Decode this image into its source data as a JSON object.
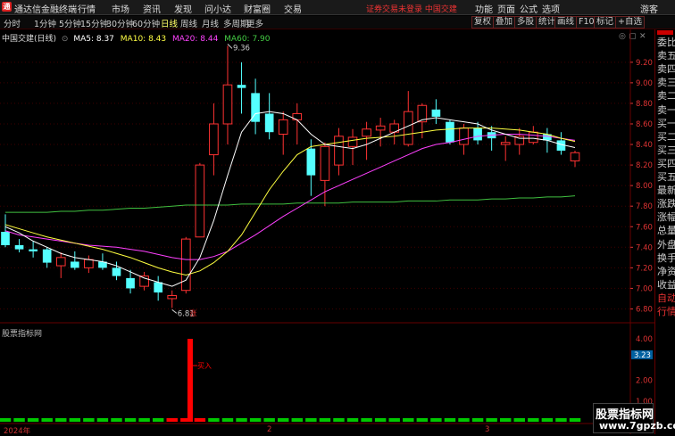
{
  "app": {
    "title": "通达信金融终端",
    "logo": "通"
  },
  "menu": [
    "行情",
    "市场",
    "资讯",
    "发现",
    "问小达",
    "财富圈",
    "交易"
  ],
  "status_text": "证券交易未登录  中国交建",
  "right_menu": [
    "功能",
    "页面",
    "公式",
    "选项"
  ],
  "guest_label": "游客",
  "period_tabs": [
    "分时",
    "1分钟",
    "5分钟",
    "15分钟",
    "30分钟",
    "60分钟",
    "日线",
    "周线",
    "月线",
    "多周期",
    "更多"
  ],
  "active_tab": "日线",
  "toolbar_buttons": [
    "复权",
    "叠加",
    "多股",
    "统计",
    "画线",
    "F10",
    "标记",
    "+自选"
  ],
  "legend": {
    "stock": "中国交建(日线)",
    "ma5": "MA5: 8.37",
    "ma10": "MA10: 8.43",
    "ma20": "MA20: 8.44",
    "ma60": "MA60: 7.90"
  },
  "colors": {
    "up": "#ff3232",
    "down": "#54ffff",
    "ma5": "#ffffff",
    "ma10": "#ffff40",
    "ma20": "#ff40ff",
    "ma60": "#40c040",
    "volume": "#00c800",
    "signal": "#ff0000",
    "grid": "#400000"
  },
  "right_panel": [
    "委比",
    "卖五",
    "卖四",
    "卖三",
    "卖二",
    "卖一",
    "买一",
    "买二",
    "买三",
    "买四",
    "买五",
    "最新",
    "涨跌",
    "涨幅",
    "总量",
    "外盘",
    "换手",
    "净资",
    "收益",
    "自动",
    "行情"
  ],
  "right_panel_top": "L",
  "price_axis": [
    "9.20",
    "9.00",
    "8.80",
    "8.60",
    "8.40",
    "8.20",
    "8.00",
    "7.80",
    "7.60",
    "7.40",
    "7.20",
    "7.00",
    "6.80"
  ],
  "annotations": {
    "high": "9.36",
    "low": "6.81",
    "mark": "涨"
  },
  "indicator": {
    "title": "股票指标网",
    "signal_label": "买入",
    "axis": [
      "4.00",
      "3.23",
      "2.00",
      "1.00",
      "0.00"
    ],
    "highlight": "3.23"
  },
  "date_axis": {
    "start": "2024年",
    "mid1": "2",
    "mid2": "3"
  },
  "bottom_text": "股票指标网",
  "badge": {
    "title": "股票指标网",
    "url": "www.7gpzb.com"
  },
  "chart_data": {
    "type": "candlestick",
    "ylim": [
      6.7,
      9.45
    ],
    "candles": [
      [
        7.55,
        7.72,
        7.4,
        7.42
      ],
      [
        7.42,
        7.48,
        7.35,
        7.38
      ],
      [
        7.38,
        7.46,
        7.3,
        7.36
      ],
      [
        7.38,
        7.4,
        7.2,
        7.25
      ],
      [
        7.22,
        7.35,
        7.1,
        7.3
      ],
      [
        7.26,
        7.36,
        7.18,
        7.2
      ],
      [
        7.2,
        7.32,
        7.15,
        7.28
      ],
      [
        7.26,
        7.34,
        7.18,
        7.2
      ],
      [
        7.2,
        7.26,
        7.08,
        7.12
      ],
      [
        7.1,
        7.18,
        6.95,
        7.0
      ],
      [
        7.02,
        7.16,
        6.98,
        7.12
      ],
      [
        7.06,
        7.12,
        6.88,
        6.96
      ],
      [
        6.9,
        6.98,
        6.81,
        6.93
      ],
      [
        6.98,
        7.5,
        6.95,
        7.48
      ],
      [
        7.5,
        8.22,
        7.5,
        8.2
      ],
      [
        8.3,
        8.8,
        8.1,
        8.6
      ],
      [
        8.6,
        9.36,
        8.4,
        8.98
      ],
      [
        8.98,
        9.2,
        8.7,
        8.95
      ],
      [
        8.9,
        9.04,
        8.5,
        8.62
      ],
      [
        8.7,
        8.9,
        8.45,
        8.52
      ],
      [
        8.5,
        8.72,
        8.3,
        8.64
      ],
      [
        8.64,
        8.8,
        8.4,
        8.7
      ],
      [
        8.36,
        8.45,
        7.9,
        8.1
      ],
      [
        8.05,
        8.42,
        7.8,
        8.38
      ],
      [
        8.2,
        8.56,
        8.1,
        8.48
      ],
      [
        8.38,
        8.55,
        8.2,
        8.47
      ],
      [
        8.48,
        8.62,
        8.25,
        8.55
      ],
      [
        8.54,
        8.66,
        8.38,
        8.58
      ],
      [
        8.52,
        8.64,
        8.4,
        8.6
      ],
      [
        8.4,
        8.92,
        8.38,
        8.72
      ],
      [
        8.62,
        8.8,
        8.46,
        8.78
      ],
      [
        8.74,
        8.84,
        8.6,
        8.67
      ],
      [
        8.62,
        8.64,
        8.4,
        8.42
      ],
      [
        8.4,
        8.6,
        8.3,
        8.56
      ],
      [
        8.56,
        8.62,
        8.4,
        8.44
      ],
      [
        8.52,
        8.58,
        8.34,
        8.46
      ],
      [
        8.4,
        8.48,
        8.24,
        8.42
      ],
      [
        8.4,
        8.56,
        8.3,
        8.48
      ],
      [
        8.42,
        8.58,
        8.4,
        8.52
      ],
      [
        8.5,
        8.56,
        8.32,
        8.44
      ],
      [
        8.44,
        8.52,
        8.3,
        8.34
      ],
      [
        8.24,
        8.34,
        8.18,
        8.32
      ]
    ],
    "ma5": [
      7.6,
      7.54,
      7.46,
      7.4,
      7.34,
      7.3,
      7.28,
      7.26,
      7.22,
      7.16,
      7.1,
      7.06,
      7.02,
      7.08,
      7.3,
      7.66,
      8.1,
      8.52,
      8.7,
      8.72,
      8.7,
      8.64,
      8.5,
      8.4,
      8.38,
      8.36,
      8.4,
      8.46,
      8.52,
      8.58,
      8.64,
      8.66,
      8.64,
      8.62,
      8.6,
      8.54,
      8.5,
      8.46,
      8.46,
      8.44,
      8.4,
      8.37
    ],
    "ma10": [
      7.62,
      7.58,
      7.54,
      7.5,
      7.47,
      7.44,
      7.41,
      7.38,
      7.34,
      7.3,
      7.25,
      7.2,
      7.16,
      7.13,
      7.17,
      7.25,
      7.36,
      7.52,
      7.74,
      7.96,
      8.14,
      8.3,
      8.38,
      8.4,
      8.42,
      8.44,
      8.46,
      8.47,
      8.48,
      8.5,
      8.52,
      8.54,
      8.55,
      8.56,
      8.56,
      8.56,
      8.55,
      8.54,
      8.52,
      8.5,
      8.46,
      8.43
    ],
    "ma20": [
      7.56,
      7.52,
      7.5,
      7.48,
      7.46,
      7.44,
      7.42,
      7.41,
      7.4,
      7.38,
      7.36,
      7.33,
      7.3,
      7.28,
      7.28,
      7.31,
      7.36,
      7.44,
      7.52,
      7.61,
      7.7,
      7.78,
      7.86,
      7.94,
      8.0,
      8.06,
      8.12,
      8.18,
      8.24,
      8.3,
      8.36,
      8.4,
      8.42,
      8.45,
      8.48,
      8.49,
      8.5,
      8.5,
      8.49,
      8.48,
      8.46,
      8.44
    ],
    "ma60": [
      7.74,
      7.74,
      7.74,
      7.74,
      7.75,
      7.75,
      7.76,
      7.76,
      7.77,
      7.78,
      7.78,
      7.79,
      7.8,
      7.81,
      7.81,
      7.81,
      7.81,
      7.82,
      7.82,
      7.82,
      7.82,
      7.83,
      7.83,
      7.83,
      7.83,
      7.84,
      7.84,
      7.84,
      7.84,
      7.85,
      7.85,
      7.85,
      7.86,
      7.86,
      7.86,
      7.87,
      7.87,
      7.88,
      7.88,
      7.89,
      7.89,
      7.9
    ],
    "signal": {
      "index": 12,
      "value": 4.0
    },
    "volume_series": "bars"
  }
}
